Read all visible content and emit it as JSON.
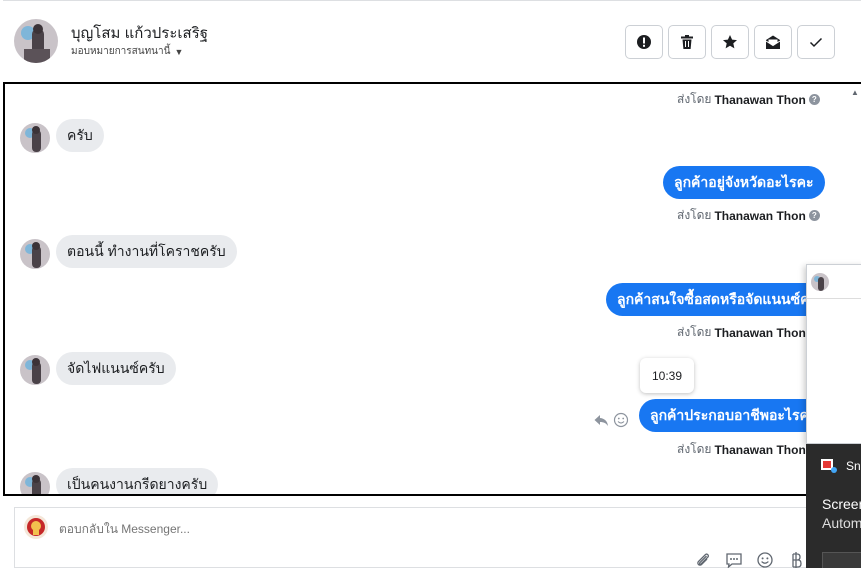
{
  "header": {
    "contact_name": "บุญโสม แก้วประเสริฐ",
    "assign_label": "มอบหมายการสนทนานี้",
    "actions": [
      {
        "name": "spam-button",
        "icon": "alert-icon"
      },
      {
        "name": "delete-button",
        "icon": "trash-icon"
      },
      {
        "name": "star-button",
        "icon": "star-icon"
      },
      {
        "name": "mark-unread-button",
        "icon": "mail-open-icon"
      },
      {
        "name": "done-button",
        "icon": "check-icon"
      }
    ]
  },
  "conversation": {
    "sent_by_prefix": "ส่งโดย",
    "agent_name": "Thanawan Thon",
    "messages": [
      {
        "dir": "in",
        "text": "ครับ"
      },
      {
        "dir": "out",
        "text": "ลูกค้าอยู่จังหวัดอะไรคะ"
      },
      {
        "dir": "in",
        "text": "ตอนนี้ ทำงานที่โคราชครับ"
      },
      {
        "dir": "out",
        "text": "ลูกค้าสนใจซื้อสดหรือจัดแนนซ์คะ"
      },
      {
        "dir": "in",
        "text": "จัดไฟแนนซ์ครับ"
      },
      {
        "dir": "out",
        "text": "ลูกค้าประกอบอาชีพอะไรคะ"
      },
      {
        "dir": "in",
        "text": "เป็นคนงานกรีดยางครับ"
      }
    ],
    "tooltip_time": "10:39"
  },
  "reply": {
    "placeholder": "ตอบกลับใน Messenger..."
  },
  "overlay": {
    "snip_app": "Snip",
    "snip_title": "Screen",
    "snip_text": "Autom"
  },
  "colors": {
    "accent": "#1877f2",
    "incoming_bubble": "#e9ebee",
    "border": "#ccd0d5"
  }
}
